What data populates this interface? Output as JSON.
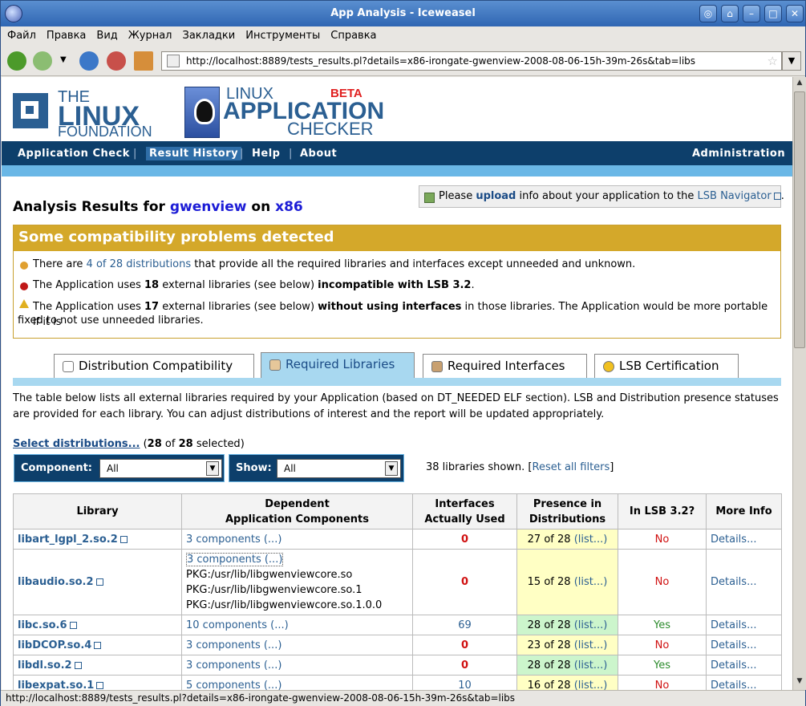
{
  "window": {
    "title": "App Analysis - Iceweasel",
    "status_url": "http://localhost:8889/tests_results.pl?details=x86-irongate-gwenview-2008-08-06-15h-39m-26s&tab=libs"
  },
  "menu": [
    "Файл",
    "Правка",
    "Вид",
    "Журнал",
    "Закладки",
    "Инструменты",
    "Справка"
  ],
  "url": "http://localhost:8889/tests_results.pl?details=x86-irongate-gwenview-2008-08-06-15h-39m-26s&tab=libs",
  "logo": {
    "the": "THE",
    "linux": "LINUX",
    "foundation": "FOUNDATION",
    "lac1": "LINUX",
    "lac2": "APPLICATION",
    "lac3": "CHECKER",
    "beta": "BETA"
  },
  "nav": {
    "app_check": "Application Check",
    "result_history": "Result History",
    "help": "Help",
    "about": "About",
    "admin": "Administration",
    "sep": "|"
  },
  "upload": {
    "pre": "Please",
    "link": "upload",
    "mid": "info about your application to the",
    "nav": "LSB Navigator",
    "end": "."
  },
  "analysis": {
    "pre": "Analysis Results for",
    "app": "gwenview",
    "on": "on",
    "arch": "x86"
  },
  "warn": {
    "head": "Some compatibility problems detected",
    "r1a": "There are",
    "r1l": "4 of 28 distributions",
    "r1b": "that provide all the required libraries and interfaces except unneeded and unknown.",
    "r2a": "The Application uses",
    "r2n": "18",
    "r2b": "external libraries (see below)",
    "r2c": "incompatible with LSB 3.2",
    "r3a": "The Application uses",
    "r3n": "17",
    "r3b": "external libraries (see below)",
    "r3c": "without using interfaces",
    "r3d": "in those libraries. The Application would be more portable if it is",
    "r3e": "fixed to not use unneeded libraries."
  },
  "tabs": [
    "Distribution Compatibility",
    "Required Libraries",
    "Required Interfaces",
    "LSB Certification"
  ],
  "desc": "The table below lists all external libraries required by your Application (based on DT_NEEDED ELF section). LSB and Distribution presence statuses are provided for each library. You can adjust distributions of interest and the report will be updated appropriately.",
  "seldist": {
    "link": "Select distributions...",
    "n1": "28",
    "of": "of",
    "n2": "28",
    "sel": "selected)",
    "open": "("
  },
  "filters": {
    "component_label": "Component:",
    "component_val": "All",
    "show_label": "Show:",
    "show_val": "All"
  },
  "shown": {
    "text": "38 libraries shown. [",
    "link": "Reset all filters",
    "end": "]"
  },
  "table": {
    "h1": "Library",
    "h2a": "Dependent",
    "h2b": "Application Components",
    "h3a": "Interfaces",
    "h3b": "Actually Used",
    "h4a": "Presence in",
    "h4b": "Distributions",
    "h5": "In LSB 3.2?",
    "h6": "More Info",
    "details": "Details...",
    "list": "(list...)",
    "no": "No",
    "yes": "Yes",
    "rows": [
      {
        "lib": "libart_lgpl_2.so.2",
        "comp": "3 components (...)",
        "used": "0",
        "pres": "27 of 28"
      },
      {
        "lib": "libaudio.so.2",
        "comp": "3 components (...)",
        "pkg1": "PKG:/usr/lib/libgwenviewcore.so",
        "pkg2": "PKG:/usr/lib/libgwenviewcore.so.1",
        "pkg3": "PKG:/usr/lib/libgwenviewcore.so.1.0.0",
        "used": "0",
        "pres": "15 of 28"
      },
      {
        "lib": "libc.so.6",
        "comp": "10 components (...)",
        "used": "69",
        "pres": "28 of 28"
      },
      {
        "lib": "libDCOP.so.4",
        "comp": "3 components (...)",
        "used": "0",
        "pres": "23 of 28"
      },
      {
        "lib": "libdl.so.2",
        "comp": "3 components (...)",
        "used": "0",
        "pres": "28 of 28"
      },
      {
        "lib": "libexpat.so.1",
        "comp": "5 components (...)",
        "used": "10",
        "pres": "16 of 28"
      }
    ]
  }
}
